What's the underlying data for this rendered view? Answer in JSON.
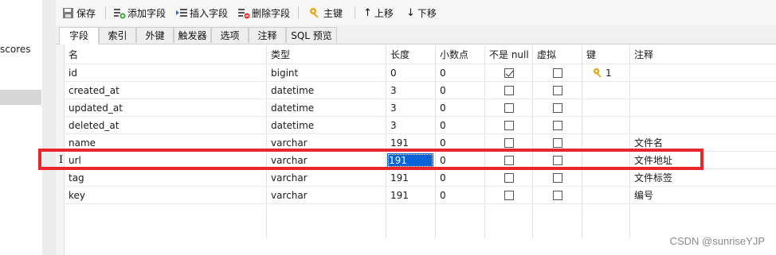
{
  "sidebar": {
    "item_label": "scores"
  },
  "toolbar": {
    "save": "保存",
    "add_field": "添加字段",
    "insert_field": "插入字段",
    "delete_field": "删除字段",
    "primary_key": "主键",
    "move_up": "上移",
    "move_down": "下移"
  },
  "tabs": [
    "字段",
    "索引",
    "外键",
    "触发器",
    "选项",
    "注释",
    "SQL 预览"
  ],
  "columns": [
    "名",
    "类型",
    "长度",
    "小数点",
    "不是 null",
    "虚拟",
    "键",
    "注释"
  ],
  "rows": [
    {
      "name": "id",
      "type": "bigint",
      "length": "0",
      "decimals": "0",
      "not_null": true,
      "virtual": false,
      "key": "1",
      "comment": ""
    },
    {
      "name": "created_at",
      "type": "datetime",
      "length": "3",
      "decimals": "0",
      "not_null": false,
      "virtual": false,
      "key": "",
      "comment": ""
    },
    {
      "name": "updated_at",
      "type": "datetime",
      "length": "3",
      "decimals": "0",
      "not_null": false,
      "virtual": false,
      "key": "",
      "comment": ""
    },
    {
      "name": "deleted_at",
      "type": "datetime",
      "length": "3",
      "decimals": "0",
      "not_null": false,
      "virtual": false,
      "key": "",
      "comment": ""
    },
    {
      "name": "name",
      "type": "varchar",
      "length": "191",
      "decimals": "0",
      "not_null": false,
      "virtual": false,
      "key": "",
      "comment": "文件名"
    },
    {
      "name": "url",
      "type": "varchar",
      "length": "191",
      "decimals": "0",
      "not_null": false,
      "virtual": false,
      "key": "",
      "comment": "文件地址"
    },
    {
      "name": "tag",
      "type": "varchar",
      "length": "191",
      "decimals": "0",
      "not_null": false,
      "virtual": false,
      "key": "",
      "comment": "文件标签"
    },
    {
      "name": "key",
      "type": "varchar",
      "length": "191",
      "decimals": "0",
      "not_null": false,
      "virtual": false,
      "key": "",
      "comment": "编号"
    }
  ],
  "watermark": "CSDN @sunriseYJP",
  "colors": {
    "highlight": "#e8262b",
    "selection": "#0a64d8",
    "key_icon": "#e6a817"
  }
}
